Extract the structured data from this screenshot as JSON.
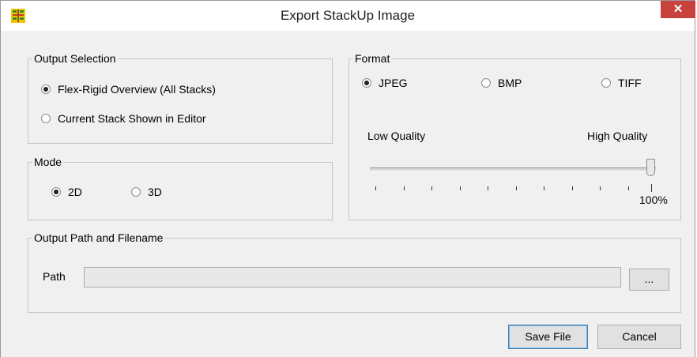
{
  "window": {
    "title": "Export StackUp Image",
    "close_glyph": "✕",
    "accent_close": "#c7413e"
  },
  "output_selection": {
    "legend": "Output Selection",
    "options": [
      {
        "label": "Flex-Rigid Overview (All Stacks)",
        "checked": true
      },
      {
        "label": "Current Stack Shown in Editor",
        "checked": false
      }
    ]
  },
  "mode": {
    "legend": "Mode",
    "options": [
      {
        "label": "2D",
        "checked": true
      },
      {
        "label": "3D",
        "checked": false
      }
    ]
  },
  "format": {
    "legend": "Format",
    "options": [
      {
        "label": "JPEG",
        "checked": true
      },
      {
        "label": "BMP",
        "checked": false
      },
      {
        "label": "TIFF",
        "checked": false
      }
    ],
    "low_label": "Low Quality",
    "high_label": "High Quality",
    "quality_value": "100%",
    "quality_level": 1.0
  },
  "output_path": {
    "legend": "Output Path and Filename",
    "path_label": "Path",
    "path_value": "",
    "browse_label": "..."
  },
  "buttons": {
    "save": "Save File",
    "cancel": "Cancel"
  }
}
